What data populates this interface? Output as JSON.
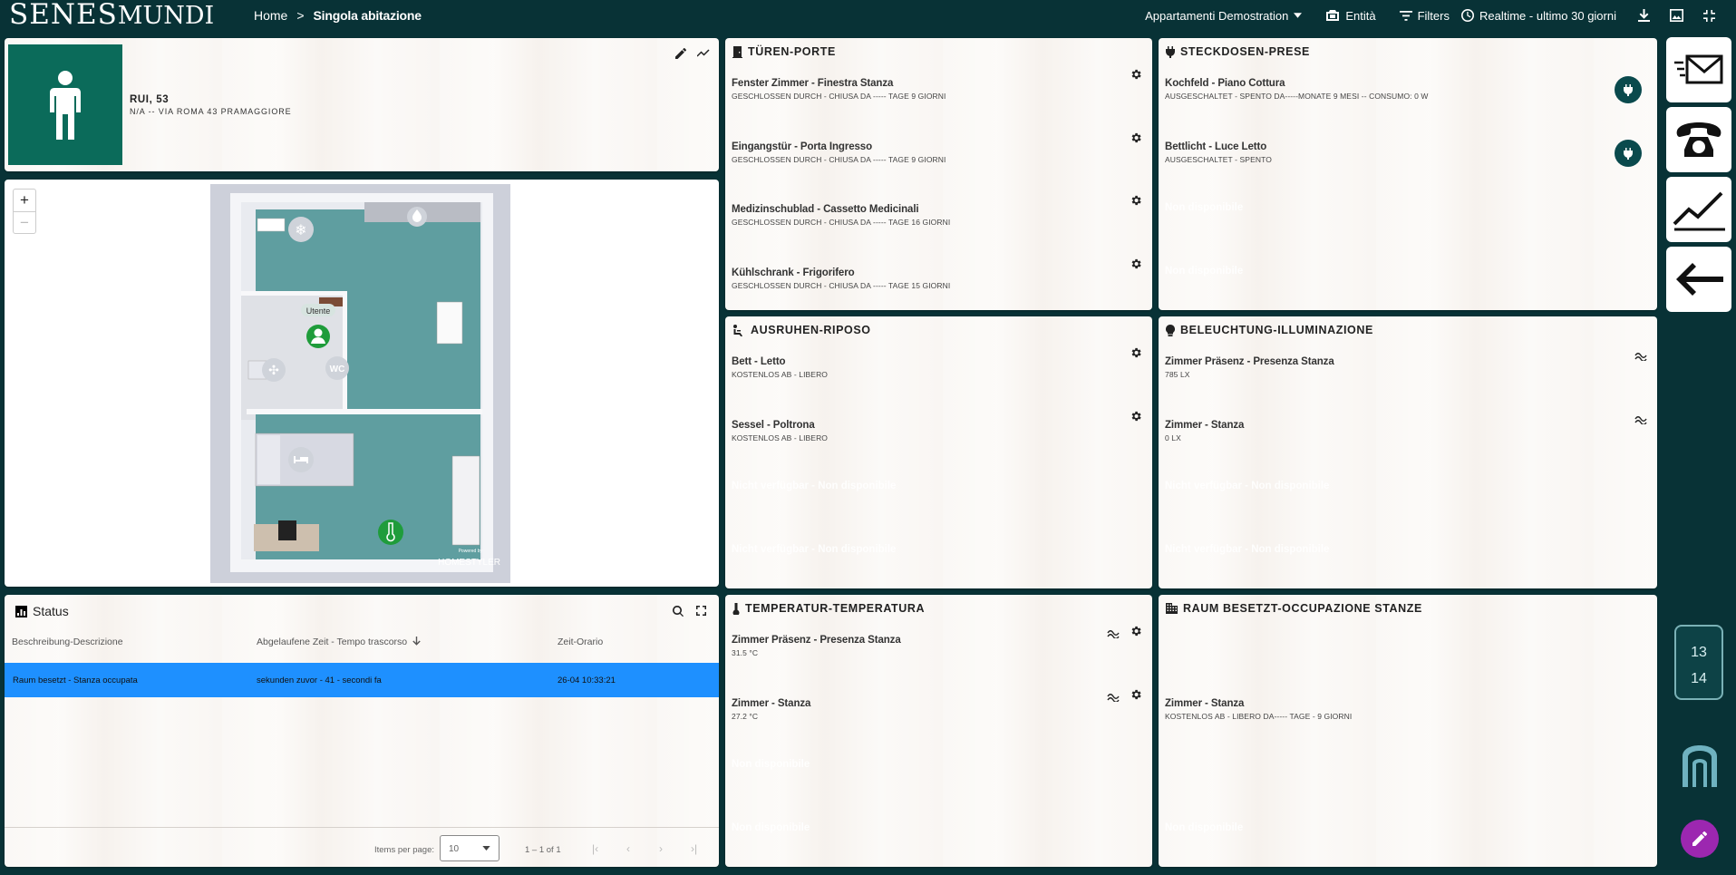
{
  "header": {
    "logo_main": "SENES",
    "logo_sub": "MUNDI",
    "breadcrumb_home": "Home",
    "breadcrumb_sep": ">",
    "breadcrumb_current": "Singola abitazione",
    "apartment_select": "Appartamenti Demostration",
    "entity_label": "Entità",
    "filters_label": "Filters",
    "realtime_label": "Realtime - ultimo 30 giorni"
  },
  "profile": {
    "name": "RUI, 53",
    "address": "N/A -- VIA ROMA 43 PRAMAGGIORE"
  },
  "map": {
    "zoom_in": "+",
    "zoom_out": "−",
    "user_label": "Utente",
    "wc_label": "WC",
    "watermark": "HOMESTYLER",
    "watermark_small": "Powered by"
  },
  "status": {
    "title": "Status",
    "columns": [
      "Beschreibung-Descrizione",
      "Abgelaufene Zeit - Tempo trascorso",
      "Zeit-Orario"
    ],
    "rows": [
      {
        "desc": "Raum besetzt - Stanza occupata",
        "elapsed": "sekunden zuvor - 41 - secondi fa",
        "time": "26-04 10:33:21"
      }
    ],
    "items_per_page_label": "Items per page:",
    "items_per_page": "10",
    "range": "1 – 1 of 1"
  },
  "doors": {
    "title": "TÜREN-PORTE",
    "items": [
      {
        "name": "Fenster Zimmer - Finestra Stanza",
        "status": "GESCHLOSSEN DURCH - CHIUSA DA ----- TAGE 9 GIORNI"
      },
      {
        "name": "Eingangstür - Porta Ingresso",
        "status": "GESCHLOSSEN DURCH - CHIUSA DA ----- TAGE 9 GIORNI"
      },
      {
        "name": "Medizinschublad - Cassetto Medicinali",
        "status": "GESCHLOSSEN DURCH - CHIUSA DA ----- TAGE 16 GIORNI"
      },
      {
        "name": "Kühlschrank - Frigorifero",
        "status": "GESCHLOSSEN DURCH - CHIUSA DA ----- TAGE 15 GIORNI"
      }
    ]
  },
  "sockets": {
    "title": "STECKDOSEN-PRESE",
    "items": [
      {
        "name": "Kochfeld - Piano Cottura",
        "status": "AUSGESCHALTET - SPENTO DA-----MONATE 9 MESI -- CONSUMO: 0 W"
      },
      {
        "name": "Bettlicht - Luce Letto",
        "status": "AUSGESCHALTET - SPENTO"
      }
    ],
    "unavailable": [
      "Non disponibile",
      "Non disponibile"
    ]
  },
  "rest": {
    "title": "AUSRUHEN-RIPOSO",
    "items": [
      {
        "name": "Bett - Letto",
        "status": "KOSTENLOS AB - LIBERO"
      },
      {
        "name": "Sessel - Poltrona",
        "status": "KOSTENLOS AB - LIBERO"
      }
    ],
    "unavailable": [
      "Nicht verfügbar - Non disponibile",
      "Nicht verfügbar - Non disponibile"
    ]
  },
  "lighting": {
    "title": "BELEUCHTUNG-ILLUMINAZIONE",
    "items": [
      {
        "name": "Zimmer Präsenz - Presenza Stanza",
        "status": "785 LX"
      },
      {
        "name": "Zimmer - Stanza",
        "status": "0 LX"
      }
    ],
    "unavailable": [
      "Nicht verfügbar - Non disponibile",
      "Nicht verfügbar - Non disponibile"
    ]
  },
  "temperature": {
    "title": "TEMPERATUR-TEMPERATURA",
    "items": [
      {
        "name": "Zimmer Präsenz - Presenza Stanza",
        "status": "31.5 °C"
      },
      {
        "name": "Zimmer - Stanza",
        "status": "27.2 °C"
      }
    ],
    "unavailable": [
      "Non disponibile",
      "Non disponibile"
    ]
  },
  "occupancy": {
    "title": "RAUM BESETZT-OCCUPAZIONE STANZE",
    "items": [
      {
        "name": "Zimmer - Stanza",
        "status": "KOSTENLOS AB - LIBERO DA----- TAGE - 9 GIORNI"
      }
    ],
    "unavailable": [
      "Non disponibile"
    ]
  },
  "sidebar": {
    "clock_hour": "13",
    "clock_minute": "14"
  },
  "colors": {
    "header_bg": "#083236",
    "avatar_bg": "#0b6b5a",
    "selected_row": "#1e90ff",
    "fab": "#9c27b0",
    "room_floor": "#5f9ea0"
  }
}
